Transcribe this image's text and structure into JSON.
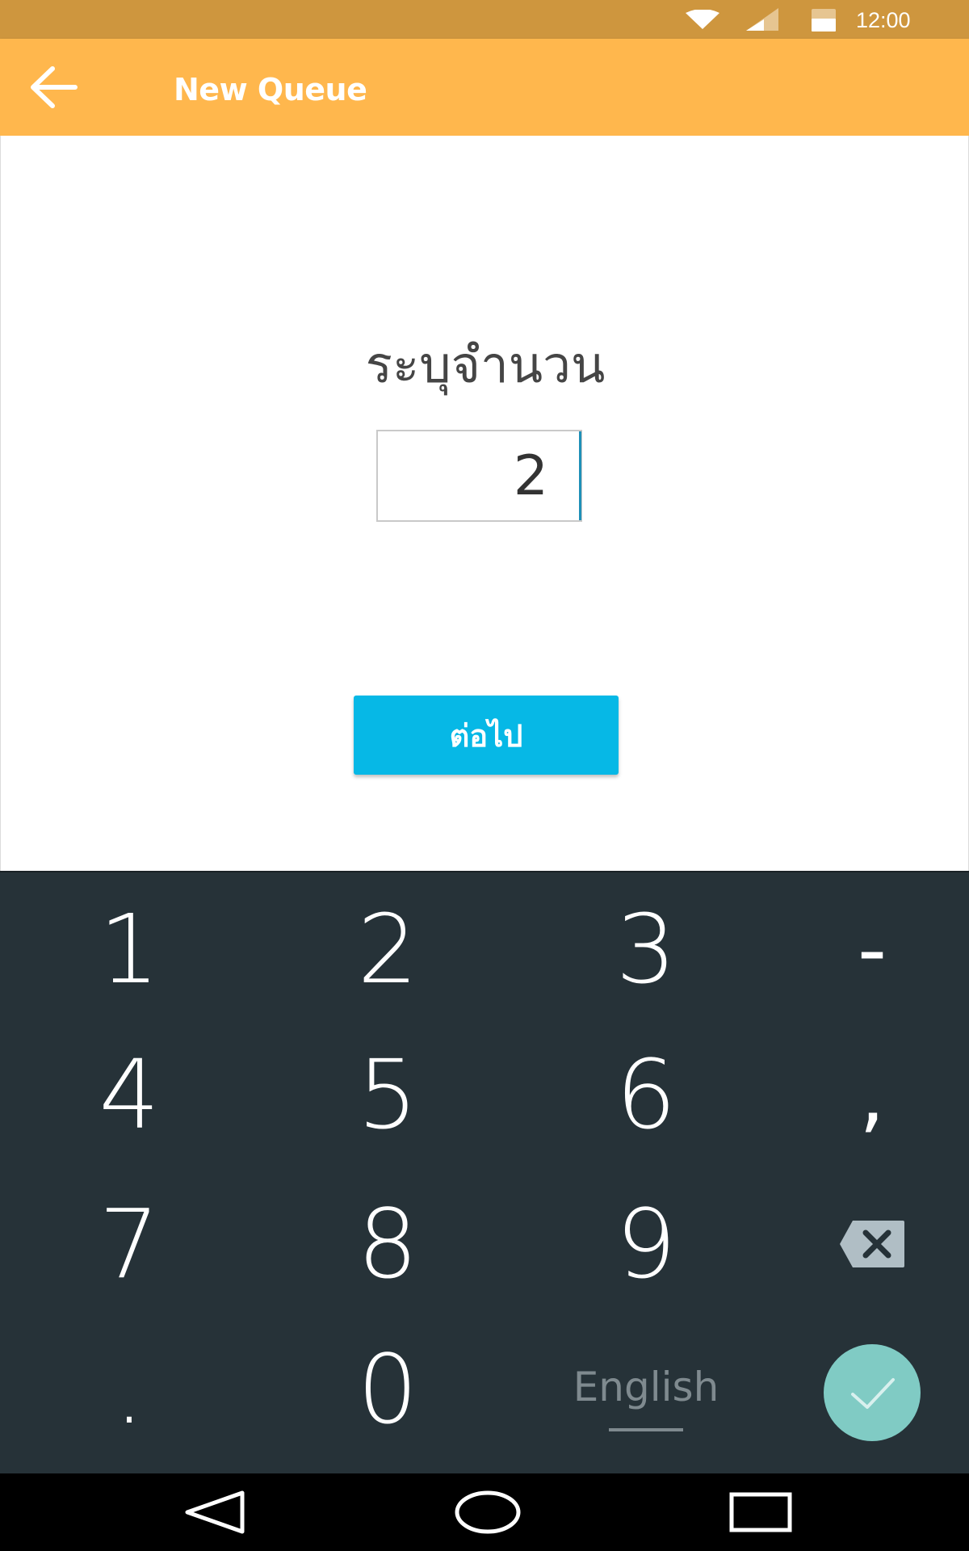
{
  "status_bar": {
    "time": "12:00",
    "icons": [
      "wifi-icon",
      "signal-icon",
      "battery-icon"
    ],
    "color": "#ce963e"
  },
  "app_bar": {
    "title": "New Queue",
    "back_icon": "arrow-back-icon",
    "color": "#ffb74d"
  },
  "form": {
    "prompt": "ระบุจำนวน",
    "quantity_value": "2",
    "next_label": "ต่อไป",
    "next_color": "#06b8e6"
  },
  "keyboard": {
    "row1": [
      "1",
      "2",
      "3",
      "-"
    ],
    "row2": [
      "4",
      "5",
      "6",
      ","
    ],
    "row3": [
      "7",
      "8",
      "9"
    ],
    "row4": [
      ".",
      "0"
    ],
    "language_label": "English",
    "backspace_icon": "backspace-icon",
    "enter_icon": "check-icon",
    "background": "#263238",
    "enter_color": "#80cbc4"
  },
  "nav_bar": {
    "icons": [
      "back-triangle-icon",
      "home-circle-icon",
      "recents-square-icon"
    ]
  }
}
